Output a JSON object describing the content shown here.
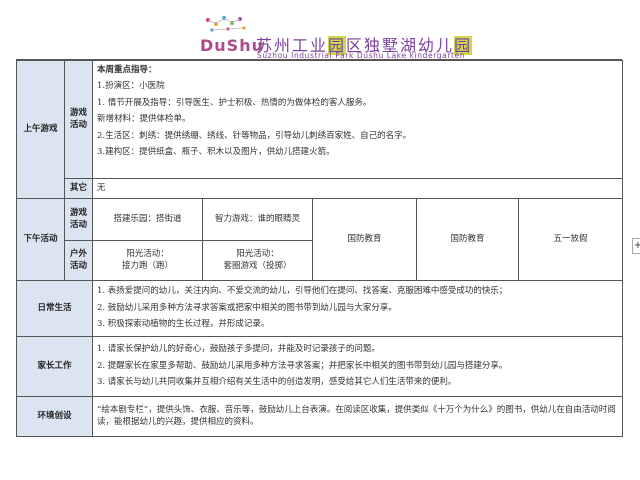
{
  "header": {
    "logo_text": "DuShu",
    "title_cn_part1": "苏州工业",
    "title_cn_hl1": "园",
    "title_cn_part2": "区",
    "title_cn_part3": "独墅湖幼儿",
    "title_cn_hl2": "园",
    "title_en": "Suzhou Industrial Park Dushu Lake kindergarten"
  },
  "morning": {
    "section_label": "上午游戏",
    "game_label": "游戏活动",
    "focus_title": "本周重点指导：",
    "lines": [
      "1.扮演区：小医院",
      "1. 情节开展及指导：引导医生、护士积极、热情的为做体检的客人服务。",
      "新增材料：提供体检单。",
      "2.生活区：刺绣：提供绣绷、绣线、针等物品，引导幼儿刺绣百家姓、自己的名字。",
      "3.建构区：提供纸盒、瓶子、积木以及图片，供幼儿搭建火箭。"
    ],
    "other_label": "其它",
    "other_value": "无"
  },
  "afternoon": {
    "section_label": "下午活动",
    "game_label": "游戏活动",
    "outdoor_label": "户外活动",
    "game_1": "搭建乐园：搭街道",
    "game_2": "智力游戏：谁的眼睛灵",
    "outdoor_1_title": "阳光活动：",
    "outdoor_1_value": "接力跑（跑）",
    "outdoor_2_title": "阳光活动：",
    "outdoor_2_value": "套圈游戏（投掷）",
    "col_3": "国防教育",
    "col_4": "国防教育",
    "col_5": "五一放假"
  },
  "daily": {
    "label": "日常生活",
    "lines": [
      "1. 表扬爱提问的幼儿，关注内向、不爱交流的幼儿，引导他们在提问、找答案、克服困难中感受成功的快乐；",
      "2. 鼓励幼儿采用多种方法寻求答案或把家中相关的图书带到幼儿园与大家分享。",
      "3. 积极探索动植物的生长过程，并形成记录。"
    ]
  },
  "parents": {
    "label": "家长工作",
    "lines": [
      "1. 请家长保护幼儿的好奇心，鼓励孩子多提问，并能及时记录孩子的问题。",
      "2. 提醒家长在家里多帮助、鼓励幼儿采用多种方法寻求答案；并把家长中相关的图书带到幼儿园与搭建分享。",
      "3. 请家长与幼儿共同收集并互相介绍有关生活中的创造发明，感受给其它人们生活带来的便利。"
    ]
  },
  "environment": {
    "label": "环境创设",
    "text": "“绘本剧专栏”，提供头饰、衣服、音乐等，鼓励幼儿上台表演。在阅读区收集，提供类似《十万个为什么》的图书，供幼儿在自由活动时阅读，能根据幼儿的兴趣，提供相应的资料。"
  },
  "side_button": "+"
}
